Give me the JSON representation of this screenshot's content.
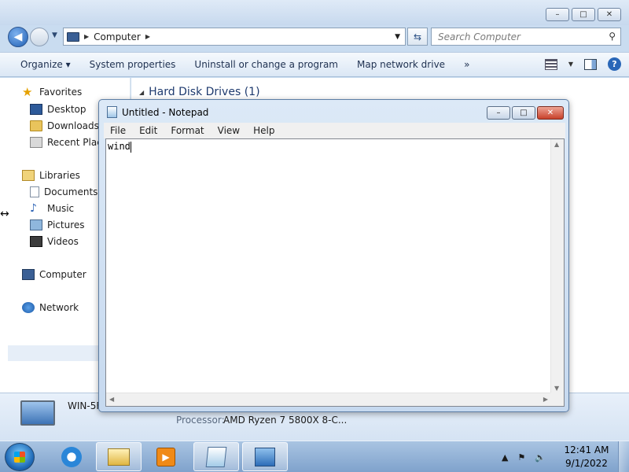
{
  "explorer": {
    "window_controls": {
      "minimize": "–",
      "maximize": "□",
      "close": "✕"
    },
    "address": {
      "icon": "computer-icon",
      "path": "Computer"
    },
    "search": {
      "placeholder": "Search Computer",
      "icon": "magnifier-icon"
    },
    "toolbar": {
      "organize": "Organize ▾",
      "system_properties": "System properties",
      "uninstall": "Uninstall or change a program",
      "map_drive": "Map network drive",
      "more": "»"
    },
    "nav": {
      "favorites": "Favorites",
      "desktop": "Desktop",
      "downloads": "Downloads",
      "recent": "Recent Place",
      "libraries": "Libraries",
      "documents": "Documents",
      "music": "Music",
      "pictures": "Pictures",
      "videos": "Videos",
      "computer": "Computer",
      "network": "Network"
    },
    "content": {
      "group_header": "Hard Disk Drives (1)"
    },
    "details": {
      "name": "WIN-5F",
      "processor_label": "Processor:",
      "processor_value": "AMD Ryzen 7 5800X 8-C..."
    }
  },
  "notepad": {
    "title": "Untitled - Notepad",
    "menu": [
      "File",
      "Edit",
      "Format",
      "View",
      "Help"
    ],
    "text": "wind"
  },
  "taskbar": {
    "apps": [
      "internet-explorer",
      "windows-explorer",
      "media-player",
      "notepad",
      "network"
    ],
    "clock": {
      "time": "12:41 AM",
      "date": "9/1/2022"
    }
  },
  "colors": {
    "accent": "#2a67b8",
    "taskbar": "#7fa2cc",
    "close": "#c8412a"
  }
}
